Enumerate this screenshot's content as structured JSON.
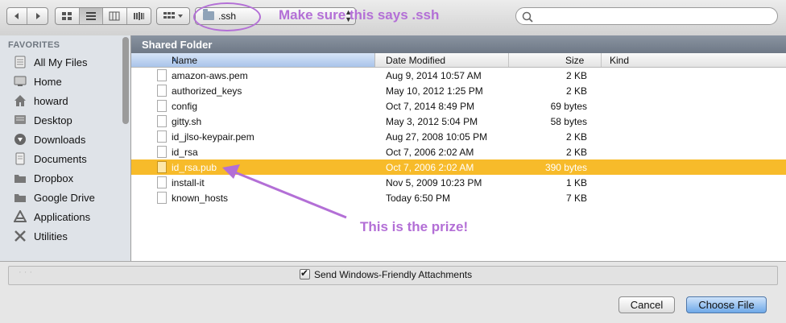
{
  "toolbar": {
    "back_icon": "chevron-left-icon",
    "forward_icon": "chevron-right-icon",
    "view_modes": [
      "icon-view",
      "list-view",
      "column-view",
      "coverflow-view"
    ],
    "arrange_icon": "arrange-grid-icon",
    "path_value": ".ssh"
  },
  "annotations": {
    "path_note": "Make sure this says .ssh",
    "prize_note": "This is the prize!",
    "color": "#b36fd6"
  },
  "sidebar": {
    "heading": "FAVORITES",
    "items": [
      {
        "label": "All My Files",
        "icon": "all-files-icon"
      },
      {
        "label": "Home",
        "icon": "home-icon"
      },
      {
        "label": "howard",
        "icon": "house-icon"
      },
      {
        "label": "Desktop",
        "icon": "desktop-icon"
      },
      {
        "label": "Downloads",
        "icon": "download-icon"
      },
      {
        "label": "Documents",
        "icon": "documents-icon"
      },
      {
        "label": "Dropbox",
        "icon": "folder-icon"
      },
      {
        "label": "Google Drive",
        "icon": "folder-icon"
      },
      {
        "label": "Applications",
        "icon": "applications-icon"
      },
      {
        "label": "Utilities",
        "icon": "utilities-icon"
      }
    ]
  },
  "browser": {
    "section_title": "Shared Folder",
    "columns": {
      "name": "Name",
      "date": "Date Modified",
      "size": "Size",
      "kind": "Kind"
    },
    "files": [
      {
        "name": "amazon-aws.pem",
        "date": "Aug 9, 2014 10:57 AM",
        "size": "2 KB"
      },
      {
        "name": "authorized_keys",
        "date": "May 10, 2012 1:25 PM",
        "size": "2 KB"
      },
      {
        "name": "config",
        "date": "Oct 7, 2014 8:49 PM",
        "size": "69 bytes"
      },
      {
        "name": "gitty.sh",
        "date": "May 3, 2012 5:04 PM",
        "size": "58 bytes"
      },
      {
        "name": "id_jlso-keypair.pem",
        "date": "Aug 27, 2008 10:05 PM",
        "size": "2 KB"
      },
      {
        "name": "id_rsa",
        "date": "Oct 7, 2006 2:02 AM",
        "size": "2 KB"
      },
      {
        "name": "id_rsa.pub",
        "date": "Oct 7, 2006 2:02 AM",
        "size": "390 bytes",
        "selected": true
      },
      {
        "name": "install-it",
        "date": "Nov 5, 2009 10:23 PM",
        "size": "1 KB"
      },
      {
        "name": "known_hosts",
        "date": "Today 6:50 PM",
        "size": "7 KB"
      }
    ],
    "selected_color": "#f7bb2a"
  },
  "options": {
    "checkbox_label": "Send Windows-Friendly Attachments",
    "checked": true
  },
  "buttons": {
    "cancel": "Cancel",
    "choose": "Choose File"
  }
}
